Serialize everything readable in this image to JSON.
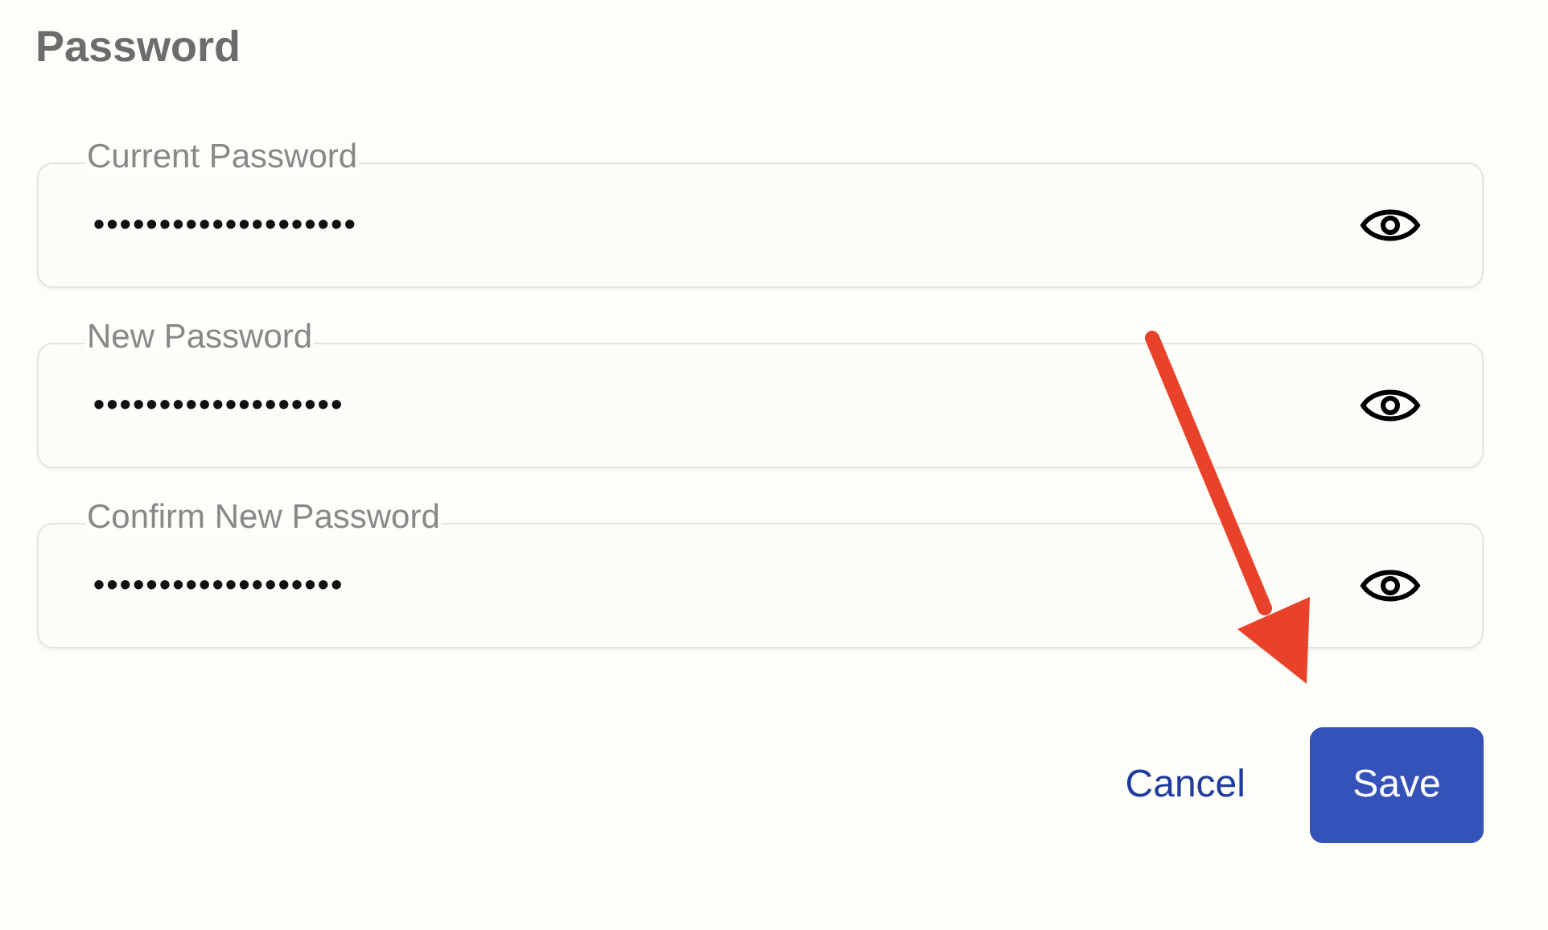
{
  "section": {
    "title": "Password"
  },
  "fields": [
    {
      "label": "Current Password",
      "value": "••••••••••••••••••••"
    },
    {
      "label": "New Password",
      "value": "•••••••••••••••••••"
    },
    {
      "label": "Confirm New Password",
      "value": "•••••••••••••••••••"
    }
  ],
  "buttons": [
    {
      "label": "Cancel",
      "kind": "text"
    },
    {
      "label": "Save",
      "kind": "primary"
    }
  ],
  "annotations": [
    {
      "kind": "arrow"
    }
  ]
}
